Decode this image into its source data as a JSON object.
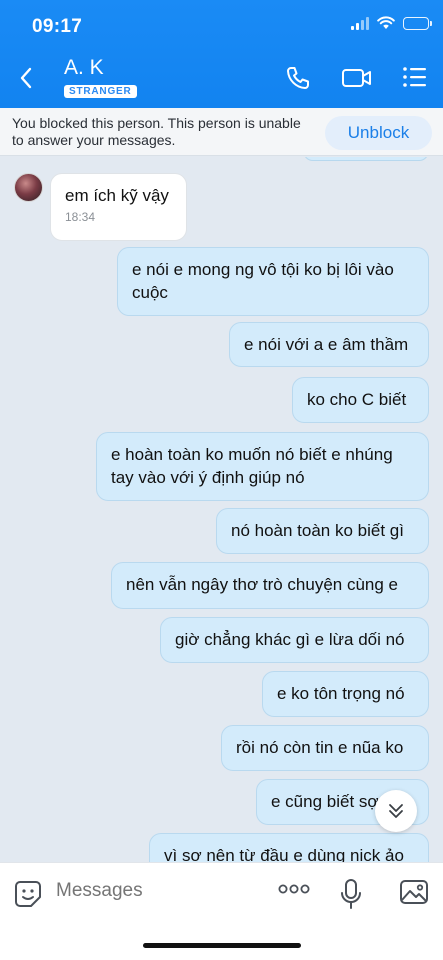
{
  "status_bar": {
    "time": "09:17"
  },
  "header": {
    "contact_name": "A. K",
    "badge": "STRANGER",
    "icons": [
      "back-chevron-icon",
      "phone-icon",
      "video-camera-icon",
      "list-menu-icon"
    ]
  },
  "banner": {
    "text": "You blocked this person. This person is unable to answer your messages.",
    "unblock_label": "Unblock"
  },
  "messages": [
    {
      "direction": "in",
      "text": "em ích kỹ vậy",
      "time": "18:34"
    },
    {
      "direction": "out",
      "text": "e nói e mong ng vô tội ko bị lôi vào cuộc"
    },
    {
      "direction": "out",
      "text": "e nói với a e âm thầm"
    },
    {
      "direction": "out",
      "text": "ko cho C biết"
    },
    {
      "direction": "out",
      "text": "e hoàn toàn ko muốn nó biết e nhúng tay vào với ý định giúp nó"
    },
    {
      "direction": "out",
      "text": "nó hoàn toàn ko biết gì"
    },
    {
      "direction": "out",
      "text": "nên vẫn ngây thơ trò chuyện cùng e"
    },
    {
      "direction": "out",
      "text": "giờ chẳng khác gì e lừa dối nó"
    },
    {
      "direction": "out",
      "text": "e ko tôn trọng nó"
    },
    {
      "direction": "out",
      "text": "rồi nó còn tin e nũa ko"
    },
    {
      "direction": "out",
      "text": "e cũng biết sợ"
    },
    {
      "direction": "out",
      "text": "vì sơ nên từ đầu e dùng nick ảo"
    }
  ],
  "composer": {
    "placeholder": "Messages",
    "icons": [
      "sticker-icon",
      "more-options-icon",
      "microphone-icon",
      "image-icon"
    ]
  },
  "colors": {
    "header_blue": "#1a8bf5",
    "outgoing_bubble": "#d3ebfb",
    "incoming_bubble": "#ffffff",
    "chat_background": "#e2e9f1",
    "unblock_text": "#1b7fe8"
  }
}
